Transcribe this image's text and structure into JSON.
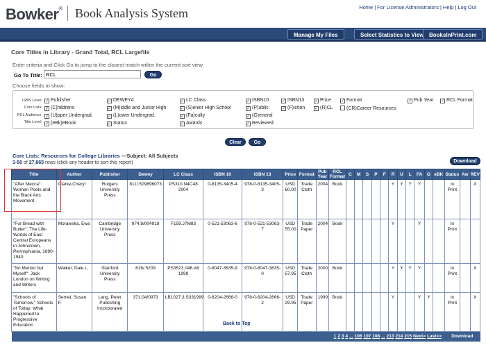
{
  "header": {
    "logo_text": "Bowker",
    "logo_mark": "®",
    "app_title": "Book Analysis System",
    "links": [
      "Home",
      "For License Administrators",
      "Help",
      "Log Out"
    ]
  },
  "nav": {
    "buttons": [
      "Manage My Files",
      "Select Statistics to View",
      "BooksInPrint.com"
    ]
  },
  "section_title": "Core Titles in Library - Grand Total, RCL Largefile",
  "instructions": "Enter criteria and Click Go to jump to the closest match within the current sort view",
  "goto": {
    "label": "Go To Title:",
    "value": "RCL",
    "go_label": "Go"
  },
  "choose_label": "Choose fields to show:",
  "fields": {
    "row_labels": [
      "ISBN Level:",
      "Core Lists:",
      "RCL Audience:",
      "Title Level:"
    ],
    "checkboxes": [
      {
        "label": "Publisher",
        "checked": true
      },
      {
        "label": "(C)hildrens",
        "checked": true
      },
      {
        "label": "(U)pper Undergrad.",
        "checked": true
      },
      {
        "label": "(eBk)eBook",
        "checked": true
      },
      {
        "label": "DEWEY#",
        "checked": true
      },
      {
        "label": "(M)iddle and Junior High",
        "checked": true
      },
      {
        "label": "(L)ower Undergrad.",
        "checked": true
      },
      {
        "label": "Status",
        "checked": true
      },
      {
        "label": "LC Class",
        "checked": true
      },
      {
        "label": "(S)enior High School",
        "checked": true
      },
      {
        "label": "(Fa)culty",
        "checked": true
      },
      {
        "label": "Awards",
        "checked": true
      },
      {
        "label": "ISBN10",
        "checked": true
      },
      {
        "label": "(P)ublic",
        "checked": true
      },
      {
        "label": "(G)eneral",
        "checked": true
      },
      {
        "label": "Reviewed",
        "checked": true
      },
      {
        "label": "ISBN13",
        "checked": true
      },
      {
        "label": "(F)iction",
        "checked": true
      },
      {
        "label": "Price",
        "checked": true
      },
      {
        "label": "(R)CL",
        "checked": true
      },
      {
        "label": "Format",
        "checked": true
      },
      {
        "label": "(CR)Career Resources",
        "checked": false
      },
      {
        "label": "Pub Year",
        "checked": true
      },
      {
        "label": "RCL Format",
        "checked": true
      }
    ]
  },
  "buttons": {
    "clear": "Clear",
    "go": "Go",
    "download": "Download"
  },
  "core_lists": {
    "prefix": "Core Lists: Resources for College Libraries",
    "subject": "—Subject: All Subjects"
  },
  "rows_info": {
    "range": "1-50",
    "of": "of",
    "total": "27,865",
    "suffix": "rows (click any header to sort this report)"
  },
  "table": {
    "columns": [
      "Title",
      "Author",
      "Publisher",
      "Dewey",
      "LC Class",
      "ISBN 10",
      "ISBN 13",
      "Price",
      "Format",
      "Pub Year",
      "RCL Format",
      "C",
      "M",
      "S",
      "P",
      "F",
      "R",
      "U",
      "L",
      "FA",
      "G",
      "eBK",
      "Status",
      "Aw",
      "REV"
    ],
    "rows": [
      [
        "\"After Mecca\": Women Poets and the Black Arts Movement",
        "Clarke,Cheryl",
        "Rutgers University Press",
        "811/.509896073",
        "PS310.N4C48 2004",
        "0-8135-3405-4",
        "978-0-8135-3405-3",
        "USD 60.00",
        "Trade Cloth",
        "2004",
        "Book",
        "",
        "",
        "",
        "",
        "",
        "Y",
        "Y",
        "Y",
        "Y",
        "",
        "",
        "In Print",
        "",
        "X"
      ],
      [
        "\"For Bread with Butter\": The Life-Worlds of East Central Europeans in Johnstown, Pennsylvania, 1890-1940",
        "Morawska, Ewa",
        "Cambridge University Press",
        "974.8/004918",
        "F159.J7M83",
        "0-521-53063-6",
        "978-0-521-53063-7",
        "USD 55.00",
        "Trade Paper",
        "2004",
        "Book",
        "",
        "",
        "",
        "",
        "",
        "Y",
        "",
        "",
        "Y",
        "",
        "",
        "In Print",
        "",
        ""
      ],
      [
        "\"No Mentor but Myself\": Jack London on Writing and Writers",
        "Walker, Dale L.",
        "Stanford University Press",
        "818/.5209",
        "PS3523.046.A6 1999",
        "0-8047-3635-9",
        "978-0-8047-3635-0",
        "USD 57.95",
        "Trade Cloth",
        "2000",
        "Book",
        "",
        "",
        "",
        "",
        "",
        "Y",
        "Y",
        "Y",
        "Y",
        "",
        "",
        "In Print",
        "",
        "X"
      ],
      [
        "\"Schools of Tomorrow,\" Schools of Today: What Happened to Progressive Education",
        "Semel, Susan F.",
        "Lang, Peter Publishing Incorporated",
        "371.04/0973",
        "LB1027.3.S331999",
        "0-8204-2666-0",
        "978-0-8204-2666-2",
        "USD 29.95",
        "Trade Paper",
        "1999",
        "Book",
        "",
        "",
        "",
        "",
        "",
        "Y",
        "",
        "",
        "Y",
        "Y",
        "",
        "In Print",
        "",
        "X"
      ]
    ]
  },
  "pager": [
    "1",
    "2",
    "3",
    "4",
    "...",
    "106",
    "107",
    "108",
    "...",
    "213",
    "214",
    "215",
    "Next>",
    "Last>>"
  ],
  "footer_download": "Download",
  "back_to_top": "Back to Top"
}
